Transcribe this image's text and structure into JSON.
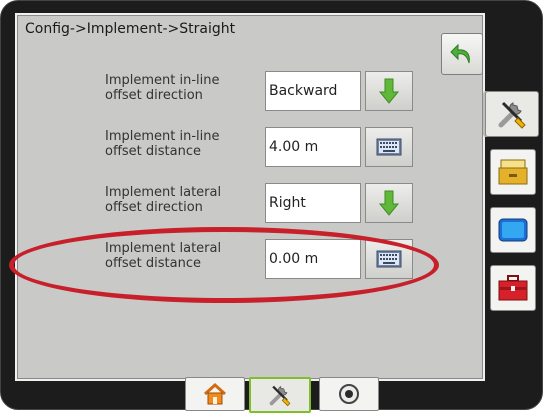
{
  "header": {
    "breadcrumb": "Config->Implement->Straight"
  },
  "settings": [
    {
      "label_line1": "Implement in-line",
      "label_line2": "offset direction",
      "value": "Backward",
      "action": "down-arrow-icon"
    },
    {
      "label_line1": "Implement in-line",
      "label_line2": "offset distance",
      "value": "4.00 m",
      "action": "keyboard-icon"
    },
    {
      "label_line1": "Implement lateral",
      "label_line2": "offset direction",
      "value": "Right",
      "action": "down-arrow-icon"
    },
    {
      "label_line1": "Implement lateral",
      "label_line2": "offset distance",
      "value": "0.00 m",
      "action": "keyboard-icon"
    }
  ],
  "side_tabs": [
    "tools-icon",
    "console-icon",
    "display-icon",
    "toolbox-icon"
  ],
  "bottom_tabs": [
    "home-icon",
    "tools-icon",
    "camera-icon"
  ],
  "colors": {
    "highlight": "#c8202a",
    "accent_green": "#5fb83a",
    "active_tab_border": "#7fbf2a"
  }
}
